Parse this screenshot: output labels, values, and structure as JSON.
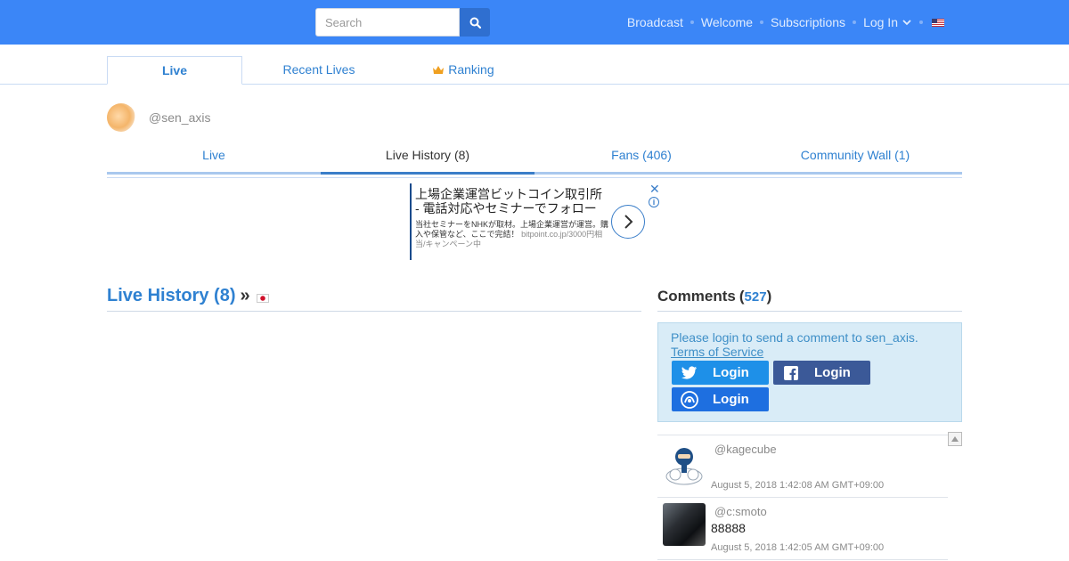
{
  "header": {
    "search_placeholder": "Search",
    "nav": [
      "Broadcast",
      "Welcome",
      "Subscriptions",
      "Log In"
    ],
    "brand_color": "#3b86f7"
  },
  "main_tabs": [
    "Live",
    "Recent Lives",
    "Ranking"
  ],
  "profile": {
    "username": "@sen_axis"
  },
  "sub_tabs": [
    "Live",
    "Live History (8)",
    "Fans (406)",
    "Community Wall (1)"
  ],
  "ad": {
    "title": "上場企業運営ビットコイン取引所 - 電話対応やセミナーでフォロー",
    "body": "当社セミナーをNHKが取材。上場企業運営が運営。購入や保管など、ここで完結！",
    "domain": "bitpoint.co.jp/3000円相当/キャンペーン中",
    "close": "✕",
    "info": "i"
  },
  "history": {
    "title": "Live History (8)",
    "raquo": "»"
  },
  "comments": {
    "title": "Comments",
    "count": "527",
    "login_msg": "Please login to send a comment to sen_axis.",
    "tos": "Terms of Service",
    "login_labels": [
      "Login",
      "Login",
      "Login"
    ],
    "items": [
      {
        "user": "@kagecube",
        "text": "",
        "date": "August 5, 2018 1:42:08 AM GMT+09:00"
      },
      {
        "user": "@c:smoto",
        "text": "88888",
        "date": "August 5, 2018 1:42:05 AM GMT+09:00"
      }
    ]
  }
}
